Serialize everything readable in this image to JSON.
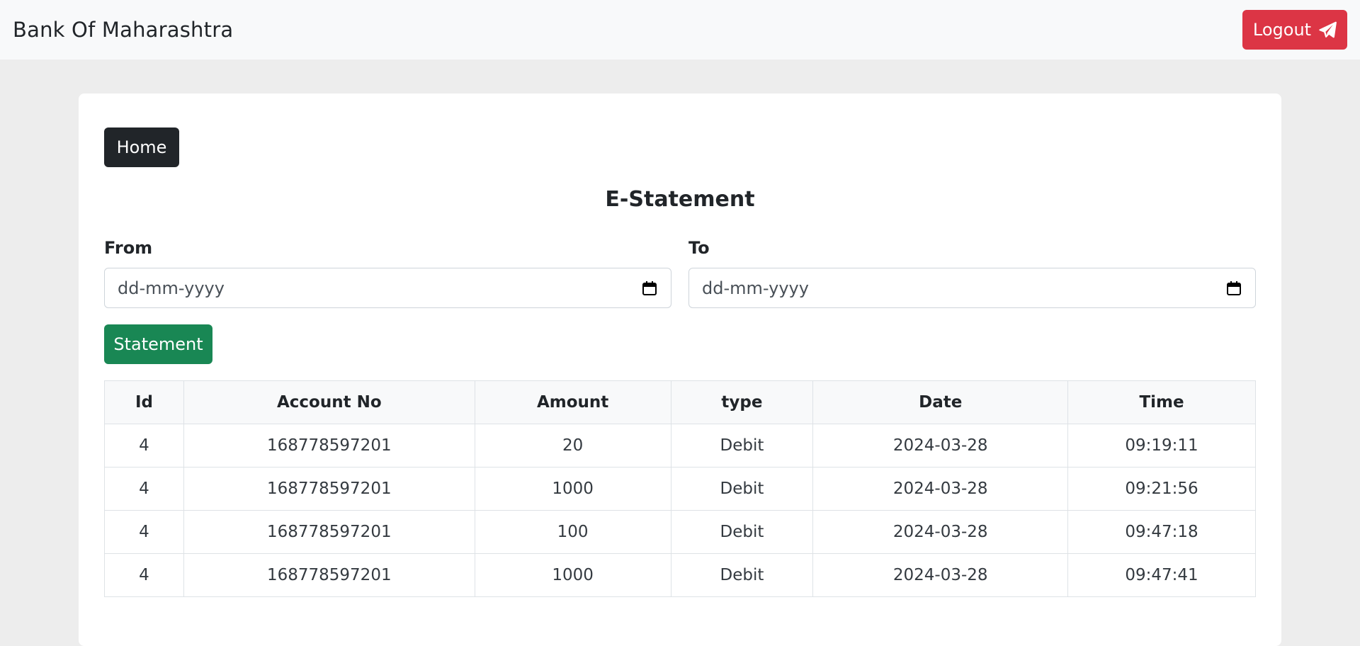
{
  "navbar": {
    "brand": "Bank Of Maharashtra",
    "logout_label": "Logout"
  },
  "card": {
    "home_label": "Home",
    "title": "E-Statement",
    "from_label": "From",
    "to_label": "To",
    "from_placeholder": "dd-mm-yyyy",
    "to_placeholder": "dd-mm-yyyy",
    "statement_label": "Statement"
  },
  "table": {
    "headers": [
      "Id",
      "Account No",
      "Amount",
      "type",
      "Date",
      "Time"
    ],
    "rows": [
      [
        "4",
        "168778597201",
        "20",
        "Debit",
        "2024-03-28",
        "09:19:11"
      ],
      [
        "4",
        "168778597201",
        "1000",
        "Debit",
        "2024-03-28",
        "09:21:56"
      ],
      [
        "4",
        "168778597201",
        "100",
        "Debit",
        "2024-03-28",
        "09:47:18"
      ],
      [
        "4",
        "168778597201",
        "1000",
        "Debit",
        "2024-03-28",
        "09:47:41"
      ]
    ]
  },
  "colors": {
    "logout": "#dc3545",
    "home": "#212529",
    "statement": "#198754"
  },
  "icons": {
    "logout": "paper-plane-icon",
    "date": "calendar-icon"
  }
}
